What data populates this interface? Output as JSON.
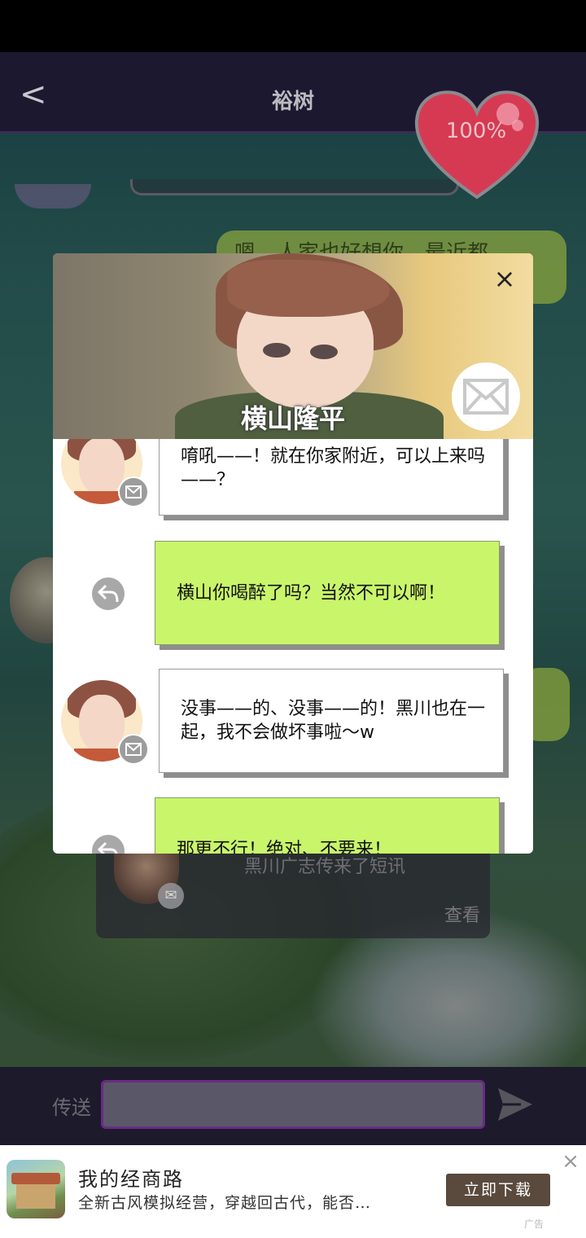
{
  "top_bar": {
    "back_glyph": "<",
    "title": "裕树"
  },
  "affection": {
    "value_text": "100%",
    "color": "#d63a52"
  },
  "background_chat": {
    "right_bubble_text": "嗯，人家也好想你。最近都"
  },
  "notification": {
    "text": "黑川广志传来了短讯",
    "action": "查看"
  },
  "modal": {
    "character_name": "横山隆平",
    "close_glyph": "×",
    "messages": [
      {
        "from": "them",
        "text": "唷吼——！就在你家附近，可以上来吗——？"
      },
      {
        "from": "me",
        "text": "横山你喝醉了吗？当然不可以啊！"
      },
      {
        "from": "them",
        "text": "没事——的、没事——的！黑川也在一起，我不会做坏事啦～w"
      },
      {
        "from": "me",
        "text": "那更不行！绝对、不要来！"
      }
    ]
  },
  "input_bar": {
    "label": "传送",
    "value": ""
  },
  "ad": {
    "title": "我的经商路",
    "description": "全新古风模拟经营，穿越回古代，能否…",
    "button": "立即下载",
    "close_glyph": "×",
    "tag": "广告"
  },
  "colors": {
    "accent_green": "#c9f56a",
    "input_border": "#6a2a86",
    "top_bar": "#1c1830"
  }
}
